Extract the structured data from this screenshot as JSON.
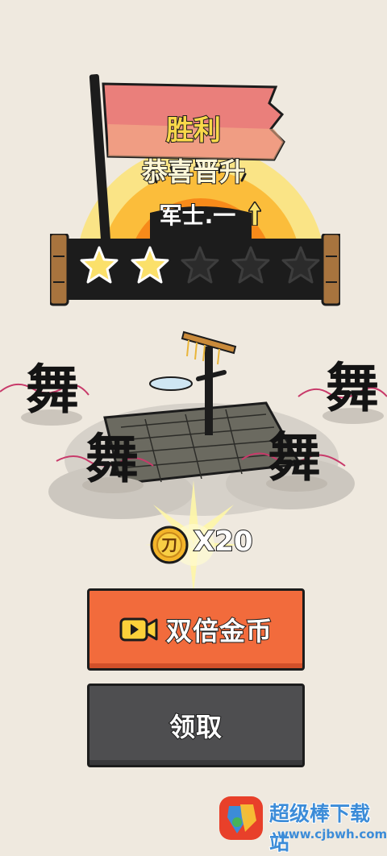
{
  "result": {
    "title": "胜利",
    "subtitle": "恭喜晋升",
    "rank": "军士.一",
    "stars_earned": 2,
    "stars_total": 5
  },
  "stage": {
    "dance_glyph": "舞"
  },
  "reward": {
    "icon": "coin-icon",
    "coin_glyph": "刀",
    "amount_text": "X20"
  },
  "buttons": {
    "double_label": "双倍金币",
    "claim_label": "领取"
  },
  "watermark": {
    "line1": "超级棒下载站",
    "line2": "www.cjbwh.com"
  },
  "colors": {
    "flag": "#ea7f7b",
    "sun_outer": "#fae486",
    "sun_mid": "#fbbd3b",
    "sun_inner": "#f78a1a",
    "star_on": "#fbe06a",
    "star_off": "#2b2b2b",
    "double_button": "#f26b3c",
    "claim_button": "#4e4e50"
  }
}
